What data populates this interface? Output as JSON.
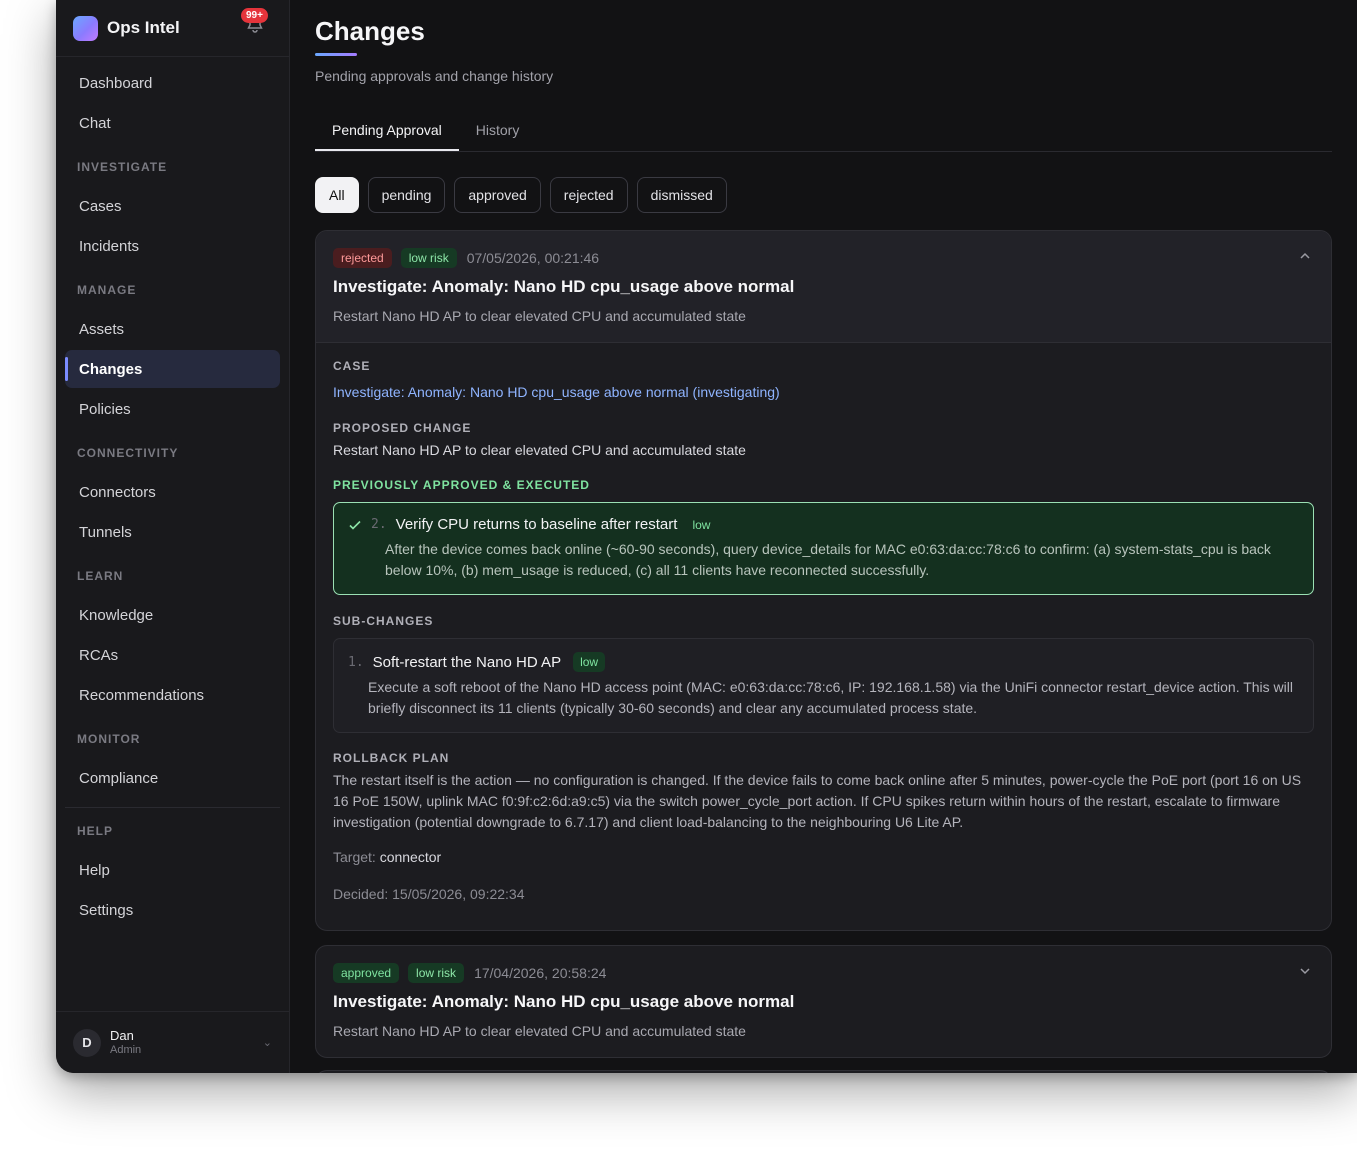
{
  "app": {
    "name": "Ops Intel",
    "notifications": "99+"
  },
  "nav": {
    "top": [
      {
        "label": "Dashboard"
      },
      {
        "label": "Chat"
      }
    ],
    "sections": [
      {
        "title": "INVESTIGATE",
        "items": [
          {
            "label": "Cases"
          },
          {
            "label": "Incidents"
          }
        ]
      },
      {
        "title": "MANAGE",
        "items": [
          {
            "label": "Assets"
          },
          {
            "label": "Changes",
            "active": true
          },
          {
            "label": "Policies"
          }
        ]
      },
      {
        "title": "CONNECTIVITY",
        "items": [
          {
            "label": "Connectors"
          },
          {
            "label": "Tunnels"
          }
        ]
      },
      {
        "title": "LEARN",
        "items": [
          {
            "label": "Knowledge"
          },
          {
            "label": "RCAs"
          },
          {
            "label": "Recommendations"
          }
        ]
      },
      {
        "title": "MONITOR",
        "items": [
          {
            "label": "Compliance"
          }
        ]
      },
      {
        "title": "HELP",
        "items": [
          {
            "label": "Help"
          },
          {
            "label": "Settings"
          }
        ]
      }
    ]
  },
  "user": {
    "initial": "D",
    "name": "Dan",
    "role": "Admin"
  },
  "page": {
    "title": "Changes",
    "subtitle": "Pending approvals and change history",
    "tabs": [
      {
        "label": "Pending Approval",
        "active": true
      },
      {
        "label": "History"
      }
    ],
    "filters": [
      {
        "label": "All",
        "active": true
      },
      {
        "label": "pending"
      },
      {
        "label": "approved"
      },
      {
        "label": "rejected"
      },
      {
        "label": "dismissed"
      }
    ]
  },
  "cards": [
    {
      "status": "rejected",
      "risk": "low risk",
      "timestamp": "07/05/2026, 00:21:46",
      "title": "Investigate: Anomaly: Nano HD cpu_usage above normal",
      "description": "Restart Nano HD AP to clear elevated CPU and accumulated state",
      "expanded": true,
      "case_label": "CASE",
      "case_link": "Investigate: Anomaly: Nano HD cpu_usage above normal (investigating)",
      "proposed_label": "PROPOSED CHANGE",
      "proposed": "Restart Nano HD AP to clear elevated CPU and accumulated state",
      "executed_label": "PREVIOUSLY APPROVED & EXECUTED",
      "executed": {
        "num": "2.",
        "title": "Verify CPU returns to baseline after restart",
        "risk": "low",
        "desc": "After the device comes back online (~60-90 seconds), query device_details for MAC e0:63:da:cc:78:c6 to confirm: (a) system-stats_cpu is back below 10%, (b) mem_usage is reduced, (c) all 11 clients have reconnected successfully."
      },
      "sub_label": "SUB-CHANGES",
      "sub": {
        "num": "1.",
        "title": "Soft-restart the Nano HD AP",
        "risk": "low",
        "desc": "Execute a soft reboot of the Nano HD access point (MAC: e0:63:da:cc:78:c6, IP: 192.168.1.58) via the UniFi connector restart_device action. This will briefly disconnect its 11 clients (typically 30-60 seconds) and clear any accumulated process state."
      },
      "rollback_label": "ROLLBACK PLAN",
      "rollback": "The restart itself is the action — no configuration is changed. If the device fails to come back online after 5 minutes, power-cycle the PoE port (port 16 on US 16 PoE 150W, uplink MAC f0:9f:c2:6d:a9:c5) via the switch power_cycle_port action. If CPU spikes return within hours of the restart, escalate to firmware investigation (potential downgrade to 6.7.17) and client load-balancing to the neighbouring U6 Lite AP.",
      "target_key": "Target:",
      "target_value": "connector",
      "decided": "Decided: 15/05/2026, 09:22:34"
    },
    {
      "status": "approved",
      "risk": "low risk",
      "timestamp": "17/04/2026, 20:58:24",
      "title": "Investigate: Anomaly: Nano HD cpu_usage above normal",
      "description": "Restart Nano HD AP to clear elevated CPU and accumulated state",
      "expanded": false
    }
  ],
  "colors": {
    "accent": "#7b8cff",
    "rejected": "#ff9a9a",
    "approved": "#7fe3a0",
    "link": "#8fb4ff",
    "background": "#121214"
  },
  "icons": [
    "bell-icon",
    "check-icon",
    "chevron-up-icon",
    "chevron-down-icon"
  ]
}
